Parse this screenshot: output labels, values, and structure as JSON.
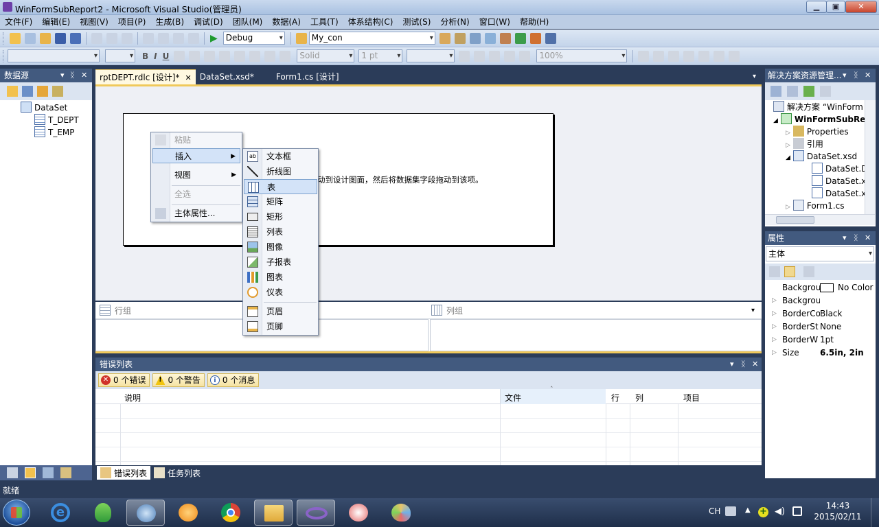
{
  "window": {
    "title": "WinFormSubReport2 - Microsoft Visual Studio(管理员)"
  },
  "menubar": [
    "文件(F)",
    "编辑(E)",
    "视图(V)",
    "项目(P)",
    "生成(B)",
    "调试(D)",
    "团队(M)",
    "数据(A)",
    "工具(T)",
    "体系结构(C)",
    "测试(S)",
    "分析(N)",
    "窗口(W)",
    "帮助(H)"
  ],
  "toolbar1": {
    "config": "Debug",
    "connection": "My_con"
  },
  "toolbar2": {
    "bold": "B",
    "italic": "I",
    "underline": "U",
    "border_style": "Solid",
    "border_width": "1 pt",
    "zoom": "100%"
  },
  "datasource": {
    "title": "数据源",
    "items": [
      {
        "label": "DataSet",
        "icon": "dataset-icon"
      },
      {
        "label": "T_DEPT",
        "icon": "table-icon"
      },
      {
        "label": "T_EMP",
        "icon": "table-icon"
      }
    ]
  },
  "tabs": [
    {
      "label": "rptDEPT.rdlc [设计]*",
      "active": true
    },
    {
      "label": "DataSet.xsd*",
      "active": false
    },
    {
      "label": "Form1.cs [设计]",
      "active": false
    }
  ],
  "designer": {
    "hint_text": "动到设计图面，然后将数据集字段拖动到该项。"
  },
  "grouping": {
    "row_groups": "行组",
    "col_groups": "列组"
  },
  "context_menu": {
    "items": [
      {
        "label": "粘贴",
        "disabled": true
      },
      {
        "label": "插入",
        "submenu": true,
        "highlight": true
      },
      {
        "label": "视图",
        "submenu": true
      },
      {
        "label": "全选",
        "disabled": true
      },
      {
        "label": "主体属性..."
      }
    ]
  },
  "insert_submenu": {
    "items": [
      {
        "label": "文本框",
        "icon": "textbox-icon"
      },
      {
        "label": "折线图",
        "icon": "line-icon"
      },
      {
        "label": "表",
        "icon": "table-icon",
        "highlight": true
      },
      {
        "label": "矩阵",
        "icon": "matrix-icon"
      },
      {
        "label": "矩形",
        "icon": "rectangle-icon"
      },
      {
        "label": "列表",
        "icon": "list-icon"
      },
      {
        "label": "图像",
        "icon": "image-icon"
      },
      {
        "label": "子报表",
        "icon": "subreport-icon"
      },
      {
        "label": "图表",
        "icon": "chart-icon"
      },
      {
        "label": "仪表",
        "icon": "gauge-icon"
      },
      {
        "label": "页眉",
        "icon": "page-header-icon"
      },
      {
        "label": "页脚",
        "icon": "page-footer-icon"
      }
    ]
  },
  "error_list": {
    "title": "错误列表",
    "filters": {
      "errors": "0 个错误",
      "warnings": "0 个警告",
      "messages": "0 个消息"
    },
    "columns": [
      "说明",
      "文件",
      "行",
      "列",
      "项目"
    ]
  },
  "bottom_tabs": [
    {
      "label": "错误列表"
    },
    {
      "label": "任务列表"
    }
  ],
  "solution": {
    "title": "解决方案资源管理...",
    "items": [
      {
        "label": "解决方案 “WinForm",
        "icon": "solution-icon"
      },
      {
        "label": "WinFormSubRe",
        "icon": "project-icon"
      },
      {
        "label": "Properties",
        "icon": "folder-icon"
      },
      {
        "label": "引用",
        "icon": "references-icon"
      },
      {
        "label": "DataSet.xsd",
        "icon": "xsd-icon"
      },
      {
        "label": "DataSet.D",
        "icon": "file-icon"
      },
      {
        "label": "DataSet.x",
        "icon": "file-icon"
      },
      {
        "label": "DataSet.x",
        "icon": "file-icon"
      },
      {
        "label": "Form1.cs",
        "icon": "form-icon"
      }
    ]
  },
  "properties": {
    "title": "属性",
    "object": "主体",
    "rows": [
      {
        "name": "Backgrou",
        "value": "No Color",
        "swatch": "#ffffff"
      },
      {
        "name": "Backgrou",
        "value": ""
      },
      {
        "name": "BorderCo",
        "value": "Black"
      },
      {
        "name": "BorderSt",
        "value": "None"
      },
      {
        "name": "BorderW",
        "value": "1pt"
      },
      {
        "name": "Size",
        "value": "6.5in, 2in",
        "bold": true
      }
    ]
  },
  "statusbar": {
    "text": "就绪"
  },
  "taskbar": {
    "lang": "CH",
    "time": "14:43",
    "date": "2015/02/11"
  },
  "colors": {
    "panel_header": "#425a7f",
    "ide_background": "#2b3c59",
    "highlight": "#d3e3f8",
    "accent_gold": "#f0c95a"
  }
}
